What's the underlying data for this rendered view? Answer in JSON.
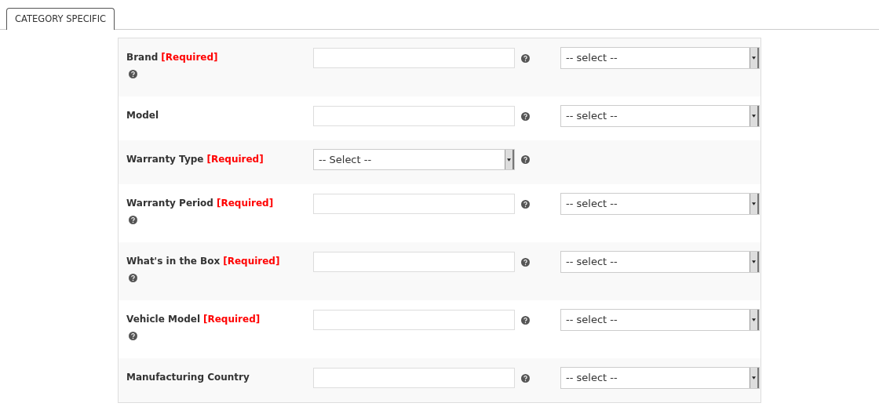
{
  "tabs": [
    {
      "label": "CATEGORY SPECIFIC",
      "selected": true
    }
  ],
  "fields": [
    {
      "label": "Brand",
      "tag": "[Required]",
      "label_help": true,
      "kind": "text_select",
      "select_text": "-- select --"
    },
    {
      "label": "Model",
      "label_help": false,
      "kind": "text_select",
      "select_text": "-- select --"
    },
    {
      "label": "Warranty Type",
      "tag": "[Required]",
      "label_help": false,
      "kind": "select",
      "select_text": "-- Select --"
    },
    {
      "label": "Warranty Period",
      "tag": "[Required]",
      "label_help": true,
      "kind": "text_select",
      "select_text": "-- select --"
    },
    {
      "label": "What's in the Box",
      "tag": "[Required]",
      "label_help": true,
      "kind": "text_select",
      "select_text": "-- select --"
    },
    {
      "label": "Vehicle Model",
      "tag": "[Required]",
      "label_help": true,
      "kind": "text_select",
      "select_text": "-- select --"
    },
    {
      "label": "Manufacturing Country",
      "label_help": false,
      "kind": "text_select",
      "select_text": "-- select --"
    }
  ]
}
